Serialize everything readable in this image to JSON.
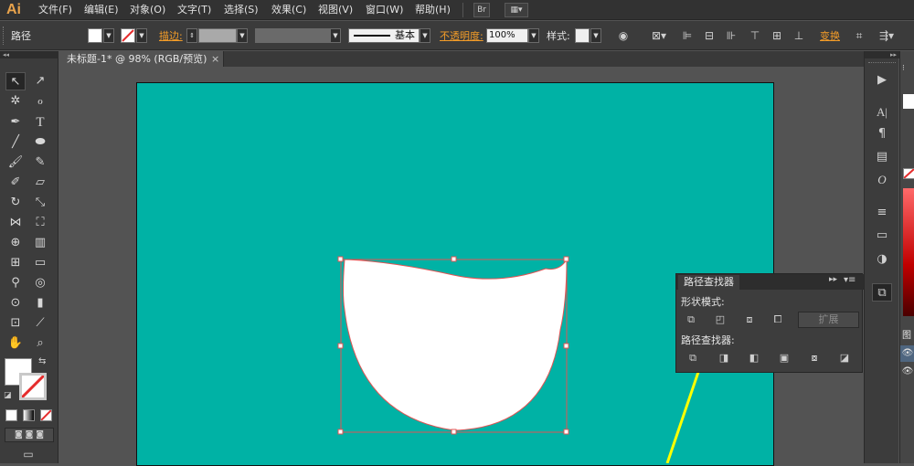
{
  "app": {
    "logo": "Ai"
  },
  "menu": {
    "items": [
      "文件(F)",
      "编辑(E)",
      "对象(O)",
      "文字(T)",
      "选择(S)",
      "效果(C)",
      "视图(V)",
      "窗口(W)",
      "帮助(H)"
    ],
    "bridge_button": "Br"
  },
  "control_bar": {
    "selection_type": "路径",
    "stroke_label": "描边:",
    "stroke_profile": "基本",
    "opacity_label": "不透明度:",
    "opacity_value": "100%",
    "style_label": "样式:",
    "transform_label": "变换"
  },
  "document": {
    "tab_title": "未标题-1* @ 98% (RGB/预览)",
    "tab_close": "×"
  },
  "colors": {
    "artboard": "#00b2a5",
    "shape_fill": "#ffffff",
    "selection": "#e05555",
    "accent": "#f39c28",
    "arrow": "#ffff00"
  },
  "pathfinder": {
    "title": "路径查找器",
    "shape_modes_label": "形状模式:",
    "pathfinders_label": "路径查找器:",
    "expand_button": "扩展",
    "shape_mode_icons": [
      "unite-icon",
      "minus-front-icon",
      "intersect-icon",
      "exclude-icon"
    ],
    "pathfinder_icons": [
      "divide-icon",
      "trim-icon",
      "merge-icon",
      "crop-icon",
      "outline-icon",
      "minus-back-icon"
    ]
  },
  "right_panel": {
    "label": "图"
  }
}
